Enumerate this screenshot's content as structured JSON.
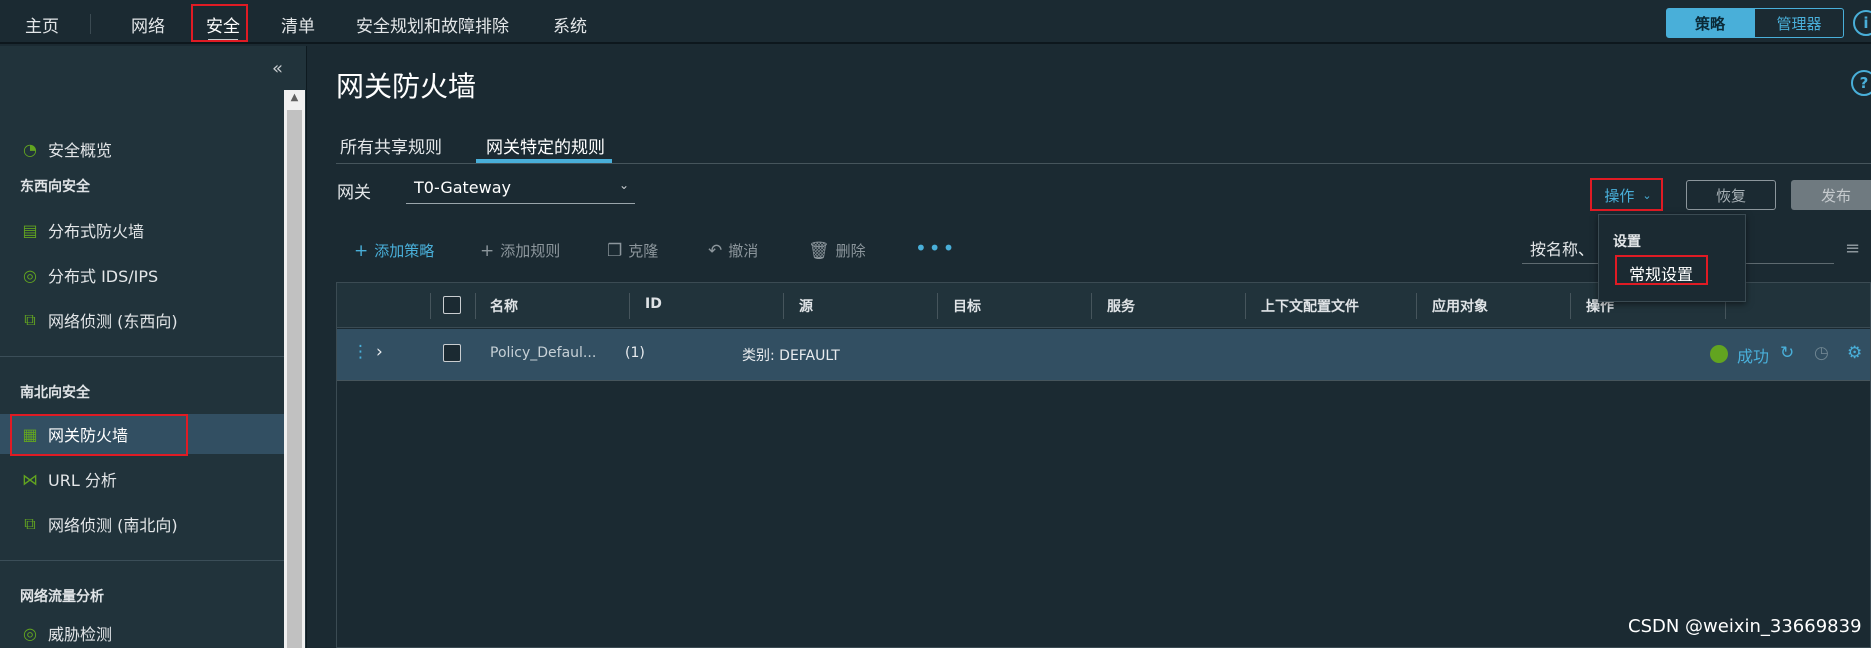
{
  "topnav": {
    "items": [
      "主页",
      "网络",
      "安全",
      "清单",
      "安全规划和故障排除",
      "系统"
    ],
    "toggle": {
      "policy": "策略",
      "manager": "管理器"
    },
    "info_icon": "info-icon"
  },
  "sidebar": {
    "overview": "安全概览",
    "ew_heading": "东西向安全",
    "ew_items": [
      "分布式防火墙",
      "分布式 IDS/IPS",
      "网络侦测 (东西向)"
    ],
    "ns_heading": "南北向安全",
    "ns_items": [
      "网关防火墙",
      "URL 分析",
      "网络侦测 (南北向)"
    ],
    "nta_heading": "网络流量分析",
    "nta_items": [
      "威胁检测"
    ]
  },
  "main": {
    "title": "网关防火墙",
    "help_icon": "help-icon",
    "tabs": [
      "所有共享规则",
      "网关特定的规则"
    ],
    "gateway_label": "网关",
    "gateway_value": "T0-Gateway",
    "actions": {
      "operations": "操作",
      "revert": "恢复",
      "publish": "发布"
    },
    "toolbar": {
      "add_policy": "添加策略",
      "add_rule": "添加规则",
      "clone": "克隆",
      "undo": "撤消",
      "delete": "删除"
    },
    "search_placeholder": "按名称、",
    "dropdown": {
      "heading": "设置",
      "item": "常规设置"
    }
  },
  "table": {
    "columns": [
      "名称",
      "ID",
      "源",
      "目标",
      "服务",
      "上下文配置文件",
      "应用对象",
      "操作"
    ],
    "row": {
      "name": "Policy_Defaul...",
      "id": "(1)",
      "category": "类别: DEFAULT",
      "status": "成功"
    }
  },
  "watermark": "CSDN @weixin_33669839",
  "colors": {
    "accent": "#49afd9",
    "success": "#62a420",
    "highlight": "#e01b24",
    "selected_row": "#324f62"
  }
}
